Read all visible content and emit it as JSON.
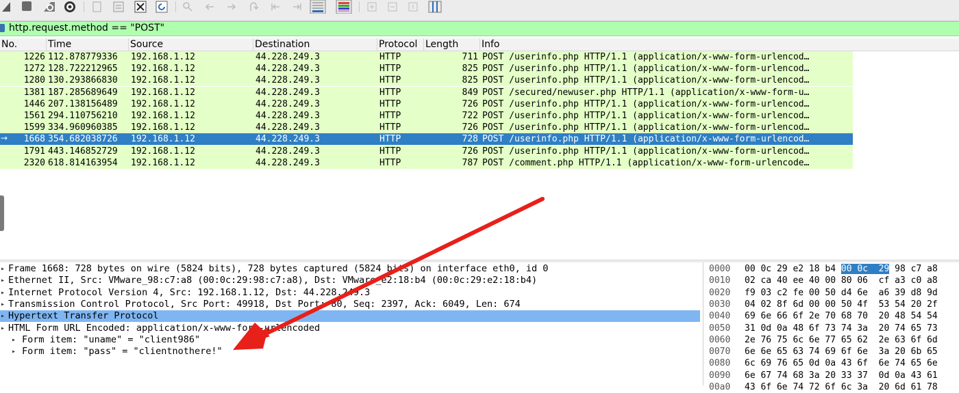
{
  "toolbar": {
    "buttons": [
      "shark-fin-icon",
      "stop-icon",
      "restart-icon",
      "options-gear-icon",
      "open-file-icon",
      "save-file-icon",
      "close-file-icon",
      "reload-file-icon",
      "find-packet-icon",
      "back-icon",
      "forward-icon",
      "go-to-packet-icon",
      "first-packet-icon",
      "last-packet-icon",
      "autoscroll-icon",
      "colorize-icon",
      "zoom-in-icon",
      "zoom-out-icon",
      "normal-size-icon",
      "resize-columns-icon"
    ]
  },
  "filter": {
    "value": "http.request.method == \"POST\""
  },
  "packet_list": {
    "columns": [
      "No.",
      "Time",
      "Source",
      "Destination",
      "Protocol",
      "Length",
      "Info"
    ],
    "rows": [
      {
        "no": "1226",
        "time": "112.878779336",
        "src": "192.168.1.12",
        "dst": "44.228.249.3",
        "proto": "HTTP",
        "len": "711",
        "info": "POST /userinfo.php HTTP/1.1  (application/x-www-form-urlencod…"
      },
      {
        "no": "1272",
        "time": "128.722212965",
        "src": "192.168.1.12",
        "dst": "44.228.249.3",
        "proto": "HTTP",
        "len": "825",
        "info": "POST /userinfo.php HTTP/1.1  (application/x-www-form-urlencod…"
      },
      {
        "no": "1280",
        "time": "130.293866830",
        "src": "192.168.1.12",
        "dst": "44.228.249.3",
        "proto": "HTTP",
        "len": "825",
        "info": "POST /userinfo.php HTTP/1.1  (application/x-www-form-urlencod…"
      },
      {
        "no": "1381",
        "time": "187.285689649",
        "src": "192.168.1.12",
        "dst": "44.228.249.3",
        "proto": "HTTP",
        "len": "849",
        "info": "POST /secured/newuser.php HTTP/1.1  (application/x-www-form-u…"
      },
      {
        "no": "1446",
        "time": "207.138156489",
        "src": "192.168.1.12",
        "dst": "44.228.249.3",
        "proto": "HTTP",
        "len": "726",
        "info": "POST /userinfo.php HTTP/1.1  (application/x-www-form-urlencod…"
      },
      {
        "no": "1561",
        "time": "294.110756210",
        "src": "192.168.1.12",
        "dst": "44.228.249.3",
        "proto": "HTTP",
        "len": "722",
        "info": "POST /userinfo.php HTTP/1.1  (application/x-www-form-urlencod…"
      },
      {
        "no": "1599",
        "time": "334.960960385",
        "src": "192.168.1.12",
        "dst": "44.228.249.3",
        "proto": "HTTP",
        "len": "726",
        "info": "POST /userinfo.php HTTP/1.1  (application/x-www-form-urlencod…"
      },
      {
        "no": "1668",
        "time": "354.682038726",
        "src": "192.168.1.12",
        "dst": "44.228.249.3",
        "proto": "HTTP",
        "len": "728",
        "info": "POST /userinfo.php HTTP/1.1  (application/x-www-form-urlencod…",
        "selected": true
      },
      {
        "no": "1791",
        "time": "443.146852729",
        "src": "192.168.1.12",
        "dst": "44.228.249.3",
        "proto": "HTTP",
        "len": "726",
        "info": "POST /userinfo.php HTTP/1.1  (application/x-www-form-urlencod…"
      },
      {
        "no": "2320",
        "time": "618.814163954",
        "src": "192.168.1.12",
        "dst": "44.228.249.3",
        "proto": "HTTP",
        "len": "787",
        "info": "POST /comment.php HTTP/1.1  (application/x-www-form-urlencode…"
      }
    ]
  },
  "details": {
    "rows": [
      {
        "text": "Frame 1668: 728 bytes on wire (5824 bits), 728 bytes captured (5824 bits) on interface eth0, id 0",
        "indent": 0
      },
      {
        "text": "Ethernet II, Src: VMware_98:c7:a8 (00:0c:29:98:c7:a8), Dst: VMware_e2:18:b4 (00:0c:29:e2:18:b4)",
        "indent": 0
      },
      {
        "text": "Internet Protocol Version 4, Src: 192.168.1.12, Dst: 44.228.249.3",
        "indent": 0
      },
      {
        "text": "Transmission Control Protocol, Src Port: 49918, Dst Port: 80, Seq: 2397, Ack: 6049, Len: 674",
        "indent": 0
      },
      {
        "text": "Hypertext Transfer Protocol",
        "indent": 0,
        "highlighted": true
      },
      {
        "text": "HTML Form URL Encoded: application/x-www-form-urlencoded",
        "indent": 0
      },
      {
        "text": "Form item: \"uname\" = \"client986\"",
        "indent": 1
      },
      {
        "text": "Form item: \"pass\" = \"clientnothere!\"",
        "indent": 1
      }
    ]
  },
  "hex": {
    "rows": [
      {
        "offset": "0000",
        "pre": "00 0c 29 e2 18 b4 ",
        "sel": "00 0c  29",
        "post": " 98 c7 a8"
      },
      {
        "offset": "0010",
        "pre": "02 ca 40 ee 40 00 80 06  cf a3 c0 a8",
        "sel": "",
        "post": ""
      },
      {
        "offset": "0020",
        "pre": "f9 03 c2 fe 00 50 d4 6e  a6 39 d8 9d",
        "sel": "",
        "post": ""
      },
      {
        "offset": "0030",
        "pre": "04 02 8f 6d 00 00 50 4f  53 54 20 2f",
        "sel": "",
        "post": ""
      },
      {
        "offset": "0040",
        "pre": "69 6e 66 6f 2e 70 68 70  20 48 54 54",
        "sel": "",
        "post": ""
      },
      {
        "offset": "0050",
        "pre": "31 0d 0a 48 6f 73 74 3a  20 74 65 73",
        "sel": "",
        "post": ""
      },
      {
        "offset": "0060",
        "pre": "2e 76 75 6c 6e 77 65 62  2e 63 6f 6d",
        "sel": "",
        "post": ""
      },
      {
        "offset": "0070",
        "pre": "6e 6e 65 63 74 69 6f 6e  3a 20 6b 65",
        "sel": "",
        "post": ""
      },
      {
        "offset": "0080",
        "pre": "6c 69 76 65 0d 0a 43 6f  6e 74 65 6e",
        "sel": "",
        "post": ""
      },
      {
        "offset": "0090",
        "pre": "6e 67 74 68 3a 20 33 37  0d 0a 43 61",
        "sel": "",
        "post": ""
      },
      {
        "offset": "00a0",
        "pre": "43 6f 6e 74 72 6f 6c 3a  20 6d 61 78",
        "sel": "",
        "post": ""
      }
    ]
  },
  "annotation": {
    "color": "#e8201a"
  },
  "colors": {
    "http_row": "#e4ffc7",
    "selected_row": "#2f7fc4",
    "filter_ok": "#afffaf",
    "detail_highlight": "#7fb6f2"
  }
}
